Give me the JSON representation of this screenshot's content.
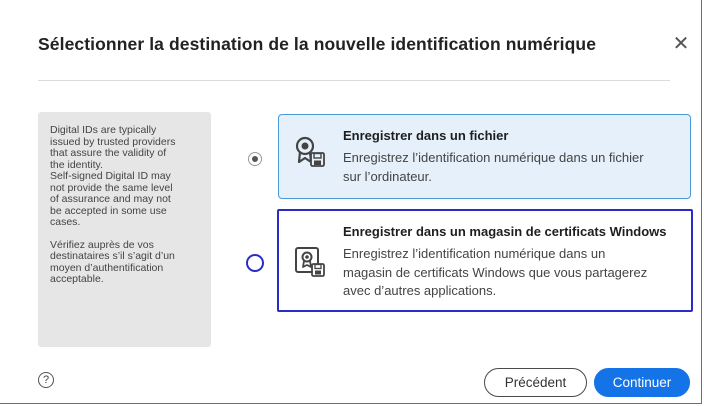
{
  "dialog": {
    "title": "Sélectionner la destination de la nouvelle identification numérique",
    "close_glyph": "✕",
    "close_icon": "close-icon"
  },
  "info_panel": {
    "paragraph1": "Digital IDs are typically\nissued by trusted providers\nthat assure the validity of\nthe identity.\nSelf-signed Digital ID may\nnot provide the same level\nof assurance and may not\nbe accepted in some use\ncases.",
    "paragraph2": "Vérifiez auprès de vos\ndestinataires s’il s’agit d’un\nmoyen d’authentification\nacceptable."
  },
  "options": [
    {
      "title": "Enregistrer dans un fichier",
      "description": "Enregistrez l’identification numérique dans un fichier\nsur l’ordinateur.",
      "selected": true,
      "icon": "certificate-file-icon"
    },
    {
      "title": "Enregistrer dans un magasin de certificats Windows",
      "description": "Enregistrez l’identification numérique dans un\nmagasin de certificats Windows que vous partagerez\navec d’autres applications.",
      "selected": false,
      "icon": "certificate-store-icon"
    }
  ],
  "footer": {
    "help_glyph": "?",
    "help_icon": "help-icon",
    "previous_label": "Précédent",
    "continue_label": "Continuer"
  },
  "colors": {
    "accent": "#1473e6",
    "selected_option_bg": "#e5f0fb",
    "selected_option_border": "#4a9ad9",
    "focus_ring": "#2a2bc8",
    "info_panel_bg": "#e6e6e6"
  }
}
